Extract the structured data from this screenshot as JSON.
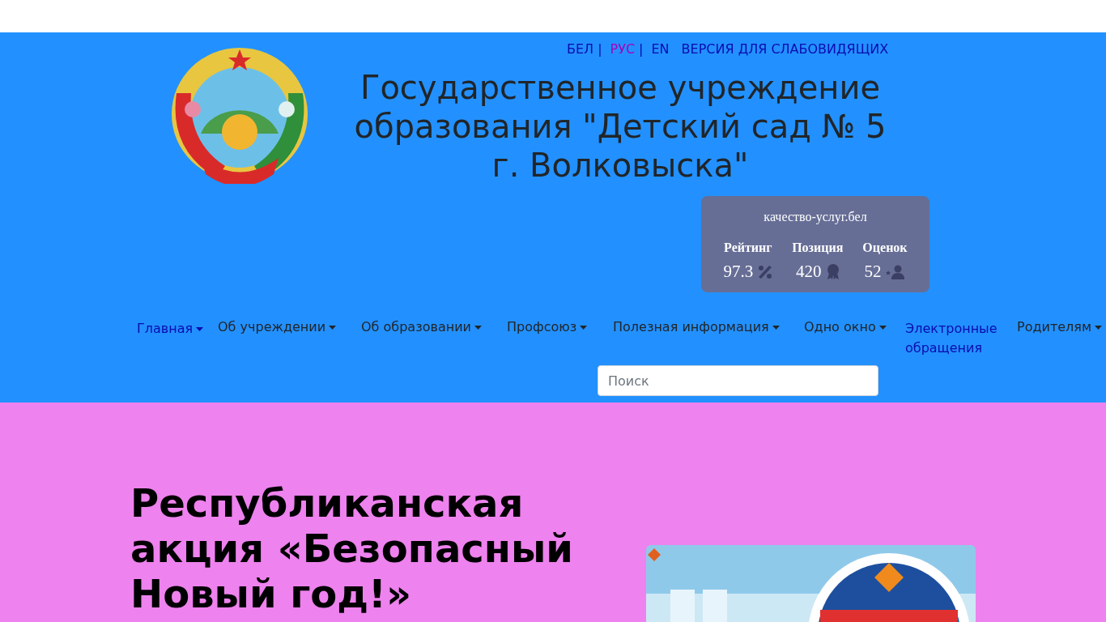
{
  "languages": [
    {
      "label": "БЕЛ",
      "selected": false,
      "separator": "|"
    },
    {
      "label": "РУС",
      "selected": true,
      "separator": "|"
    },
    {
      "label": "EN",
      "selected": false
    }
  ],
  "accessibility_link": "ВЕРСИЯ ДЛЯ СЛАБОВИДЯЩИХ",
  "title": "Государственное учреждение образования \"Детский сад № 5 г. Волковыска\"",
  "rating_widget": {
    "site": "качество-услуг.бел",
    "metrics": [
      {
        "label": "Рейтинг",
        "value": "97.3",
        "kind": "percent"
      },
      {
        "label": "Позиция",
        "value": "420",
        "kind": "award"
      },
      {
        "label": "Оценок",
        "value": "52",
        "kind": "users"
      }
    ]
  },
  "nav": [
    {
      "label": "Главная",
      "dropdown": true,
      "highlighted": true
    },
    {
      "label": "Об учреждении",
      "dropdown": true,
      "highlighted": false
    },
    {
      "label": "Об образовании",
      "dropdown": true,
      "highlighted": false
    },
    {
      "label": "Профсоюз",
      "dropdown": true,
      "highlighted": false
    },
    {
      "label": "Полезная информация",
      "dropdown": true,
      "highlighted": false
    },
    {
      "label": "Одно окно",
      "dropdown": true,
      "highlighted": false
    },
    {
      "label": "Электронные обращения",
      "dropdown": false,
      "highlighted": true
    },
    {
      "label": "Родителям",
      "dropdown": true,
      "highlighted": false
    }
  ],
  "search": {
    "placeholder": "Поиск"
  },
  "article": {
    "heading": "Республиканская акция «Безопасный Новый год!»"
  }
}
